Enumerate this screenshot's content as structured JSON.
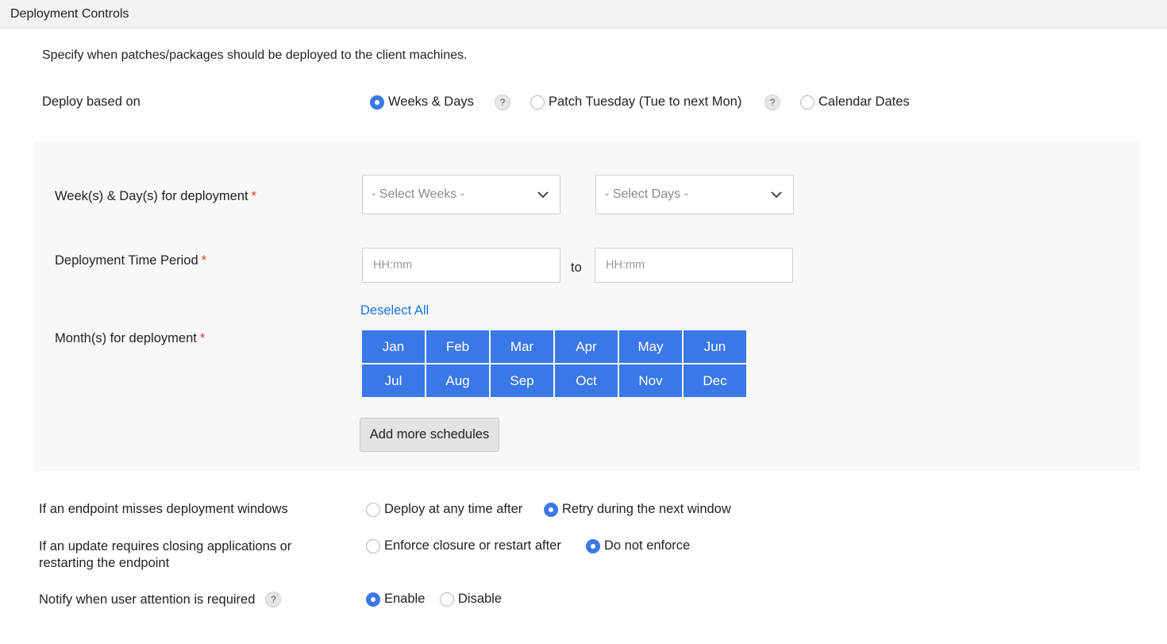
{
  "header": {
    "title": "Deployment Controls"
  },
  "description": "Specify when patches/packages should be deployed to the client machines.",
  "deploy_based_on": {
    "label": "Deploy based on",
    "options": [
      {
        "label": "Weeks & Days",
        "selected": true
      },
      {
        "label": "Patch Tuesday (Tue to next Mon)",
        "selected": false
      },
      {
        "label": "Calendar Dates",
        "selected": false
      }
    ],
    "help": "?"
  },
  "schedule": {
    "weeks_days_label": "Week(s) & Day(s) for deployment",
    "required_mark": "*",
    "weeks_placeholder": "- Select Weeks -",
    "days_placeholder": "- Select Days -",
    "time_period_label": "Deployment Time Period",
    "time_from_placeholder": "HH:mm",
    "time_to_label": "to",
    "time_to_placeholder": "HH:mm",
    "months_label": "Month(s) for deployment",
    "deselect_all": "Deselect All",
    "months": [
      "Jan",
      "Feb",
      "Mar",
      "Apr",
      "May",
      "Jun",
      "Jul",
      "Aug",
      "Sep",
      "Oct",
      "Nov",
      "Dec"
    ],
    "add_more": "Add more schedules"
  },
  "missed_window": {
    "label": "If an endpoint misses deployment windows",
    "options": [
      {
        "label": "Deploy at any time after",
        "selected": false
      },
      {
        "label": "Retry during the next window",
        "selected": true
      }
    ]
  },
  "closing_apps": {
    "label_line1": "If an update requires closing applications or",
    "label_line2": "restarting the endpoint",
    "options": [
      {
        "label": "Enforce closure or restart after",
        "selected": false
      },
      {
        "label": "Do not enforce",
        "selected": true
      }
    ]
  },
  "notify": {
    "label": "Notify when user attention is required",
    "options": [
      {
        "label": "Enable",
        "selected": true
      },
      {
        "label": "Disable",
        "selected": false
      }
    ]
  },
  "colors": {
    "accent": "#3b78e7",
    "link": "#1a73e8",
    "required": "#e53935"
  }
}
